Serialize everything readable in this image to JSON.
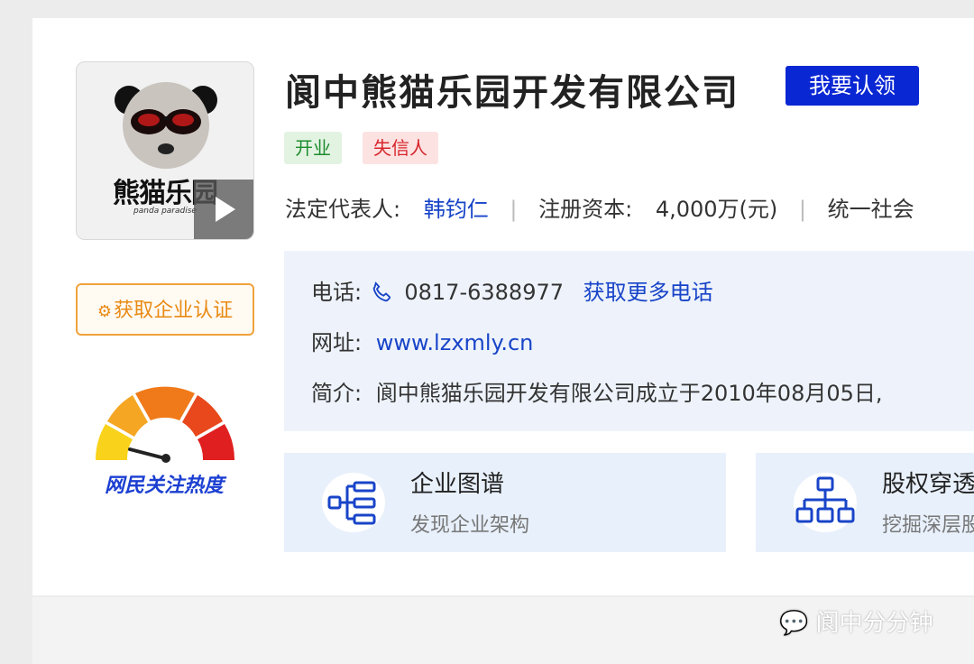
{
  "company": {
    "logo_text": "熊猫乐园",
    "logo_subtext": "panda paradise",
    "name": "阆中熊猫乐园开发有限公司",
    "claim_label": "我要认领",
    "tags": [
      "开业",
      "失信人"
    ]
  },
  "info": {
    "legal_rep_label": "法定代表人:",
    "legal_rep": "韩钧仁",
    "capital_label": "注册资本:",
    "capital": "4,000万(元)",
    "credit_label": "统一社会"
  },
  "contact": {
    "phone_label": "电话:",
    "phone": "0817-6388977",
    "more_phones": "获取更多电话",
    "website_label": "网址:",
    "website": "www.lzxmly.cn",
    "intro_label": "简介:",
    "intro": "阆中熊猫乐园开发有限公司成立于2010年08月05日,"
  },
  "sidebar": {
    "cert_button": "获取企业认证",
    "heat_label": "网民关注热度"
  },
  "features": [
    {
      "title": "企业图谱",
      "subtitle": "发现企业架构",
      "icon": "org-chart-icon"
    },
    {
      "title": "股权穿透",
      "subtitle": "挖掘深层股",
      "icon": "hierarchy-icon"
    }
  ],
  "watermark": "阆中分分钟",
  "colors": {
    "primary_blue": "#0a27d4",
    "link_blue": "#1844c8",
    "tag_green": "#1d8c2e",
    "tag_red": "#d6252a",
    "cert_orange": "#e98a14"
  }
}
